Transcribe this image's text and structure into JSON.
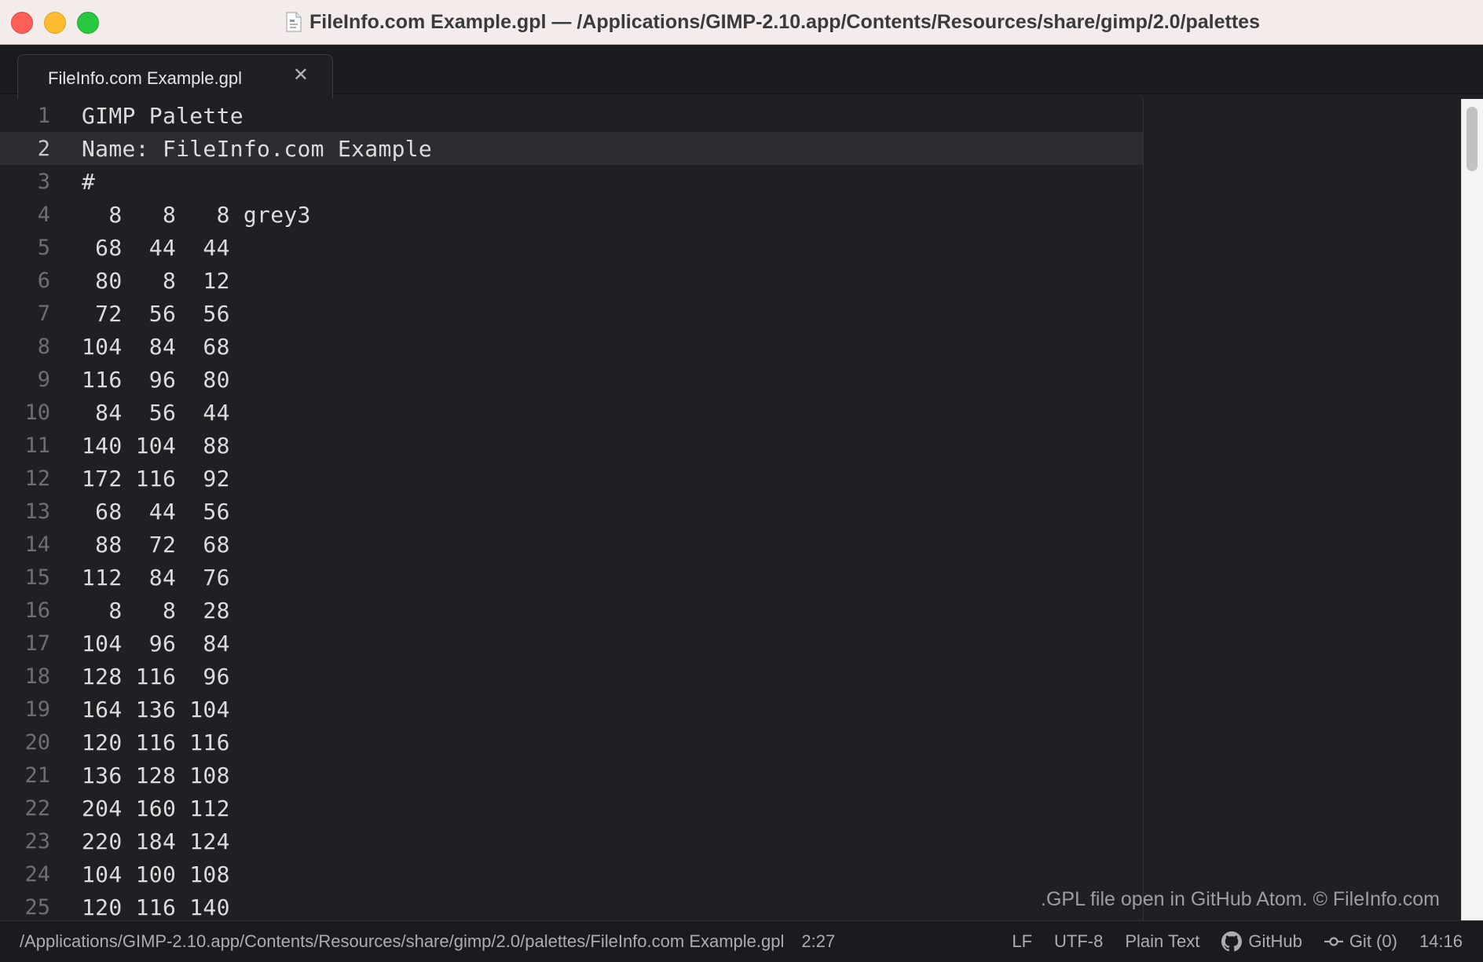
{
  "window": {
    "title": "FileInfo.com Example.gpl — /Applications/GIMP-2.10.app/Contents/Resources/share/gimp/2.0/palettes"
  },
  "tabs": [
    {
      "label": "FileInfo.com Example.gpl",
      "close": "✕"
    }
  ],
  "editor": {
    "current_line": 2,
    "lines": [
      {
        "num": "1",
        "text": "GIMP Palette"
      },
      {
        "num": "2",
        "text": "Name: FileInfo.com Example"
      },
      {
        "num": "3",
        "text": "#"
      },
      {
        "num": "4",
        "text": "  8   8   8 grey3"
      },
      {
        "num": "5",
        "text": " 68  44  44"
      },
      {
        "num": "6",
        "text": " 80   8  12"
      },
      {
        "num": "7",
        "text": " 72  56  56"
      },
      {
        "num": "8",
        "text": "104  84  68"
      },
      {
        "num": "9",
        "text": "116  96  80"
      },
      {
        "num": "10",
        "text": " 84  56  44"
      },
      {
        "num": "11",
        "text": "140 104  88"
      },
      {
        "num": "12",
        "text": "172 116  92"
      },
      {
        "num": "13",
        "text": " 68  44  56"
      },
      {
        "num": "14",
        "text": " 88  72  68"
      },
      {
        "num": "15",
        "text": "112  84  76"
      },
      {
        "num": "16",
        "text": "  8   8  28"
      },
      {
        "num": "17",
        "text": "104  96  84"
      },
      {
        "num": "18",
        "text": "128 116  96"
      },
      {
        "num": "19",
        "text": "164 136 104"
      },
      {
        "num": "20",
        "text": "120 116 116"
      },
      {
        "num": "21",
        "text": "136 128 108"
      },
      {
        "num": "22",
        "text": "204 160 112"
      },
      {
        "num": "23",
        "text": "220 184 124"
      },
      {
        "num": "24",
        "text": "104 100 108"
      },
      {
        "num": "25",
        "text": "120 116 140"
      }
    ]
  },
  "watermark": ".GPL file open in GitHub Atom. © FileInfo.com",
  "status": {
    "path": "/Applications/GIMP-2.10.app/Contents/Resources/share/gimp/2.0/palettes/FileInfo.com Example.gpl",
    "position": "2:27",
    "line_ending": "LF",
    "encoding": "UTF-8",
    "grammar": "Plain Text",
    "github": "GitHub",
    "git": "Git (0)",
    "time": "14:16"
  },
  "colors": {
    "editor_bg": "#1f2023",
    "close": "#fe5f57",
    "minimize": "#febc2e",
    "maximize": "#28c840"
  }
}
